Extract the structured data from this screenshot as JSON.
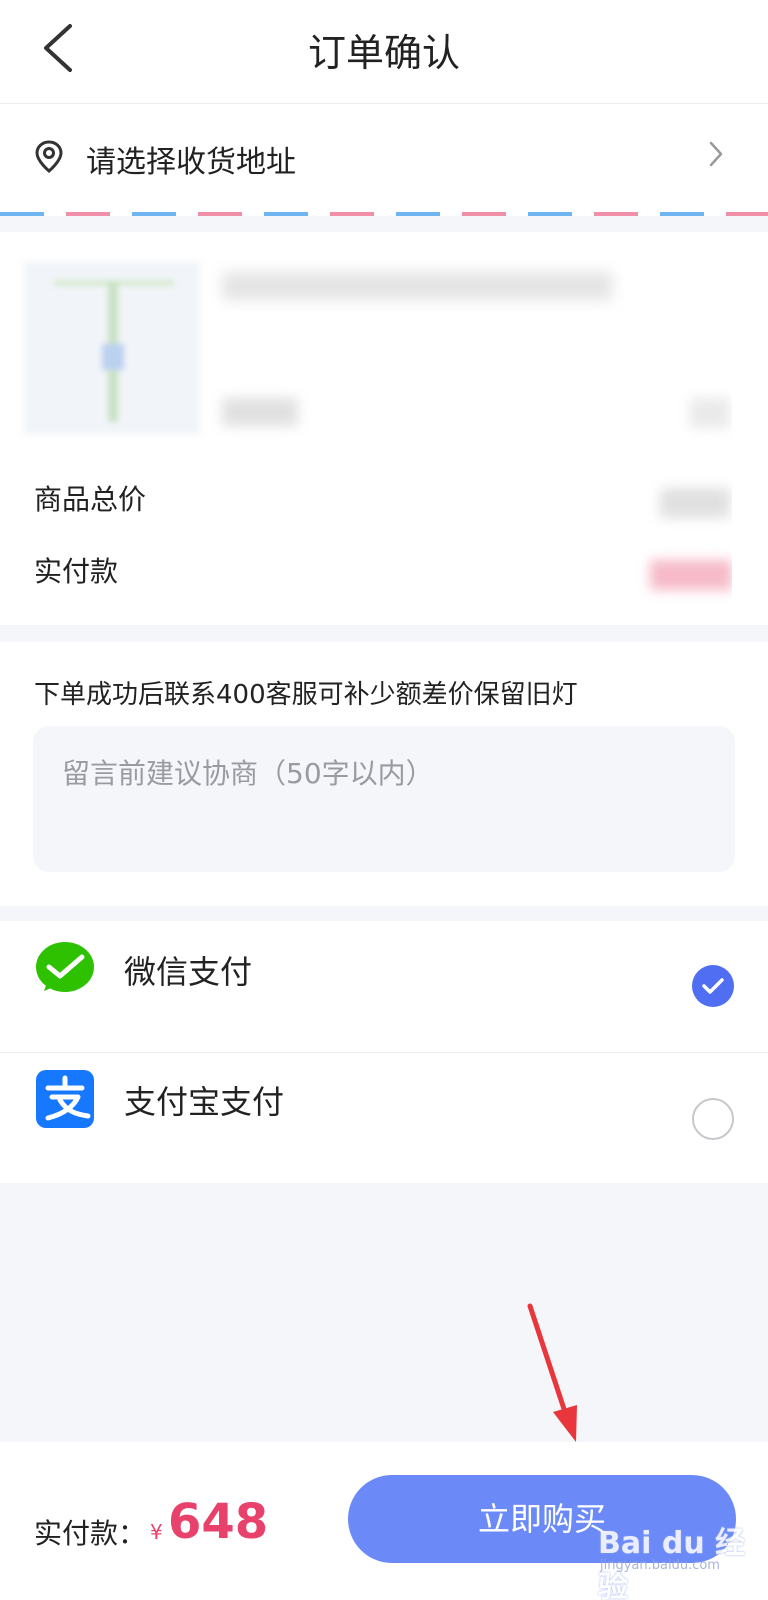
{
  "header": {
    "title": "订单确认"
  },
  "address": {
    "prompt": "请选择收货地址"
  },
  "order": {
    "goods_total_label": "商品总价",
    "actual_pay_label": "实付款"
  },
  "message": {
    "note": "下单成功后联系400客服可补少额差价保留旧灯",
    "placeholder": "留言前建议协商（50字以内）"
  },
  "payment": {
    "options": [
      {
        "label": "微信支付",
        "icon": "wechat-pay-icon",
        "selected": true,
        "color": "#2dc100"
      },
      {
        "label": "支付宝支付",
        "icon": "alipay-icon",
        "selected": false,
        "color": "#1677ff"
      }
    ]
  },
  "footer": {
    "pay_label": "实付款：",
    "currency": "¥",
    "amount": "648",
    "buy_button": "立即购买"
  },
  "watermark": {
    "brand": "Bai du 经验",
    "url": "jingyan.baidu.com"
  },
  "colors": {
    "accent": "#6b8af7",
    "price": "#e8416b",
    "radio_selected": "#4f6ef2"
  }
}
